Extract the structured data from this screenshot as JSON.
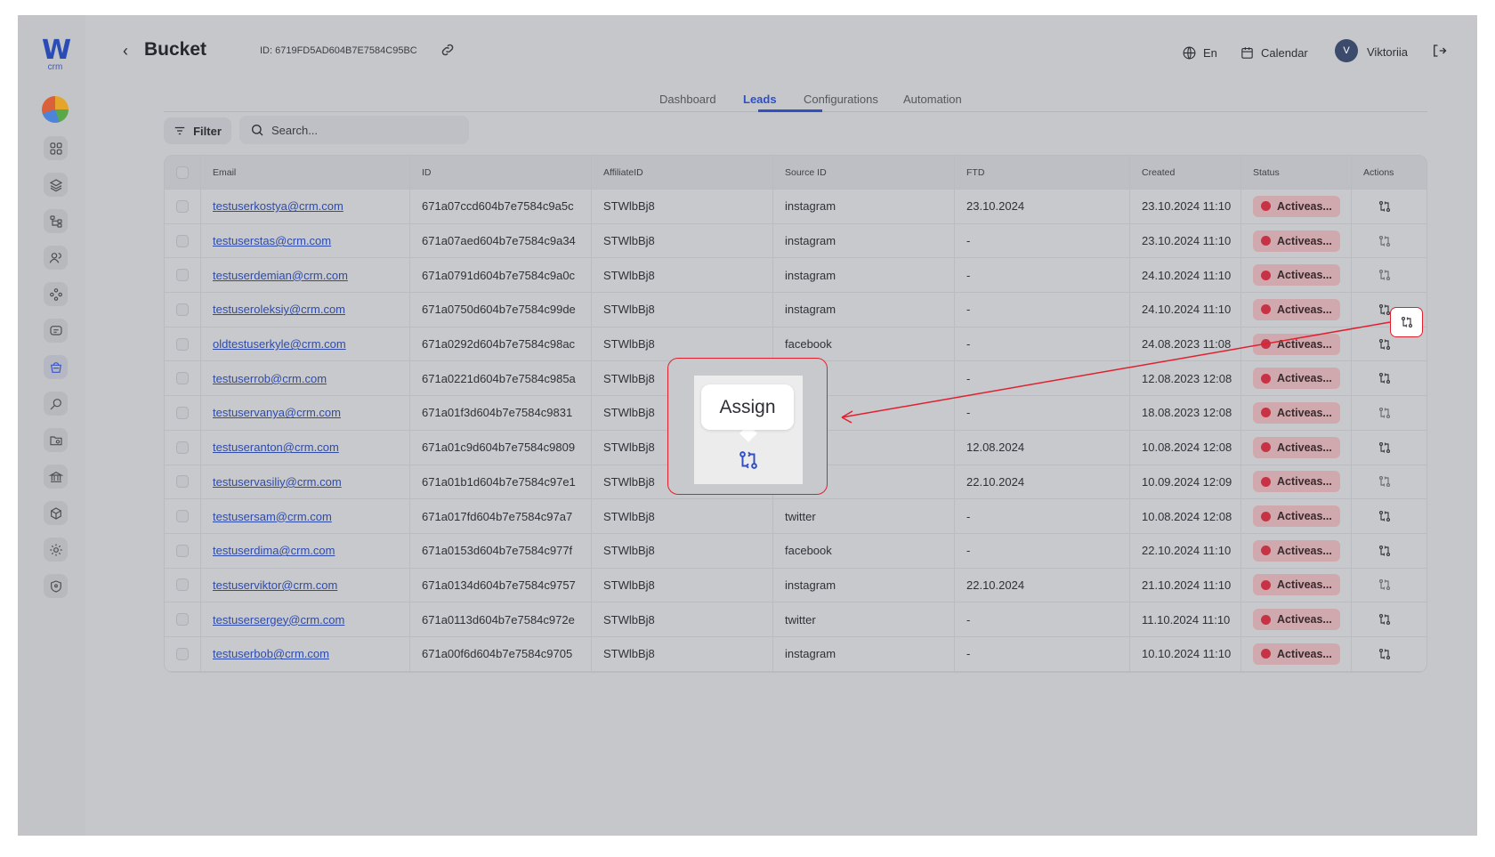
{
  "app": {
    "logo_text": "W",
    "logo_sub": "crm"
  },
  "sidebar": {
    "items": [
      {
        "icon": "grid-icon"
      },
      {
        "icon": "layers-icon"
      },
      {
        "icon": "hierarchy-icon"
      },
      {
        "icon": "users-icon"
      },
      {
        "icon": "network-icon"
      },
      {
        "icon": "message-icon"
      },
      {
        "icon": "bucket-icon",
        "active": true
      },
      {
        "icon": "search-key-icon"
      },
      {
        "icon": "folder-icon"
      },
      {
        "icon": "bank-icon"
      },
      {
        "icon": "cube-icon"
      },
      {
        "icon": "gear-icon"
      },
      {
        "icon": "shield-icon"
      }
    ]
  },
  "header": {
    "title": "Bucket",
    "bucket_id": "ID: 6719FD5AD604B7E7584C95BC",
    "language": "En",
    "calendar": "Calendar",
    "avatar_initial": "V",
    "username": "Viktoriia"
  },
  "tabs": [
    "Dashboard",
    "Leads",
    "Configurations",
    "Automation"
  ],
  "active_tab": "Leads",
  "toolbar": {
    "filter_label": "Filter",
    "search_placeholder": "Search..."
  },
  "table": {
    "columns": [
      "Email",
      "ID",
      "AffiliateID",
      "Source ID",
      "FTD",
      "Created",
      "Status",
      "Actions"
    ],
    "rows": [
      [
        "testuserkostya@crm.com",
        "671a07ccd604b7e7584c9a5c",
        "STWlbBj8",
        "instagram",
        "23.10.2024",
        "23.10.2024 11:10",
        "Activeas..."
      ],
      [
        "testuserstas@crm.com",
        "671a07aed604b7e7584c9a34",
        "STWlbBj8",
        "instagram",
        "-",
        "23.10.2024 11:10",
        "Activeas..."
      ],
      [
        "testuserdemian@crm.com",
        "671a0791d604b7e7584c9a0c",
        "STWlbBj8",
        "instagram",
        "-",
        "24.10.2024 11:10",
        "Activeas..."
      ],
      [
        "testuseroleksiy@crm.com",
        "671a0750d604b7e7584c99de",
        "STWlbBj8",
        "instagram",
        "-",
        "24.10.2024 11:10",
        "Activeas..."
      ],
      [
        "oldtestuserkyle@crm.com",
        "671a0292d604b7e7584c98ac",
        "STWlbBj8",
        "facebook",
        "-",
        "24.08.2023 11:08",
        "Activeas..."
      ],
      [
        "testuserrob@crm.com",
        "671a0221d604b7e7584c985a",
        "STWlbBj8",
        "",
        "-",
        "12.08.2023 12:08",
        "Activeas..."
      ],
      [
        "testuservanya@crm.com",
        "671a01f3d604b7e7584c9831",
        "STWlbBj8",
        "",
        "-",
        "18.08.2023 12:08",
        "Activeas..."
      ],
      [
        "testuseranton@crm.com",
        "671a01c9d604b7e7584c9809",
        "STWlbBj8",
        "",
        "12.08.2024",
        "10.08.2024 12:08",
        "Activeas..."
      ],
      [
        "testuservasiliy@crm.com",
        "671a01b1d604b7e7584c97e1",
        "STWlbBj8",
        "",
        "22.10.2024",
        "10.09.2024 12:09",
        "Activeas..."
      ],
      [
        "testusersam@crm.com",
        "671a017fd604b7e7584c97a7",
        "STWlbBj8",
        "twitter",
        "-",
        "10.08.2024 12:08",
        "Activeas..."
      ],
      [
        "testuserdima@crm.com",
        "671a0153d604b7e7584c977f",
        "STWlbBj8",
        "facebook",
        "-",
        "22.10.2024 11:10",
        "Activeas..."
      ],
      [
        "testuserviktor@crm.com",
        "671a0134d604b7e7584c9757",
        "STWlbBj8",
        "instagram",
        "22.10.2024",
        "21.10.2024 11:10",
        "Activeas..."
      ],
      [
        "testusersergey@crm.com",
        "671a0113d604b7e7584c972e",
        "STWlbBj8",
        "twitter",
        "-",
        "11.10.2024 11:10",
        "Activeas..."
      ],
      [
        "testuserbob@crm.com",
        "671a00f6d604b7e7584c9705",
        "STWlbBj8",
        "instagram",
        "-",
        "10.10.2024 11:10",
        "Activeas..."
      ]
    ]
  },
  "callout": {
    "tooltip": "Assign",
    "icon": "assign-icon"
  },
  "colors": {
    "accent": "#2f4fc2",
    "status_dot": "#c83245",
    "annotation": "#e0202f"
  }
}
